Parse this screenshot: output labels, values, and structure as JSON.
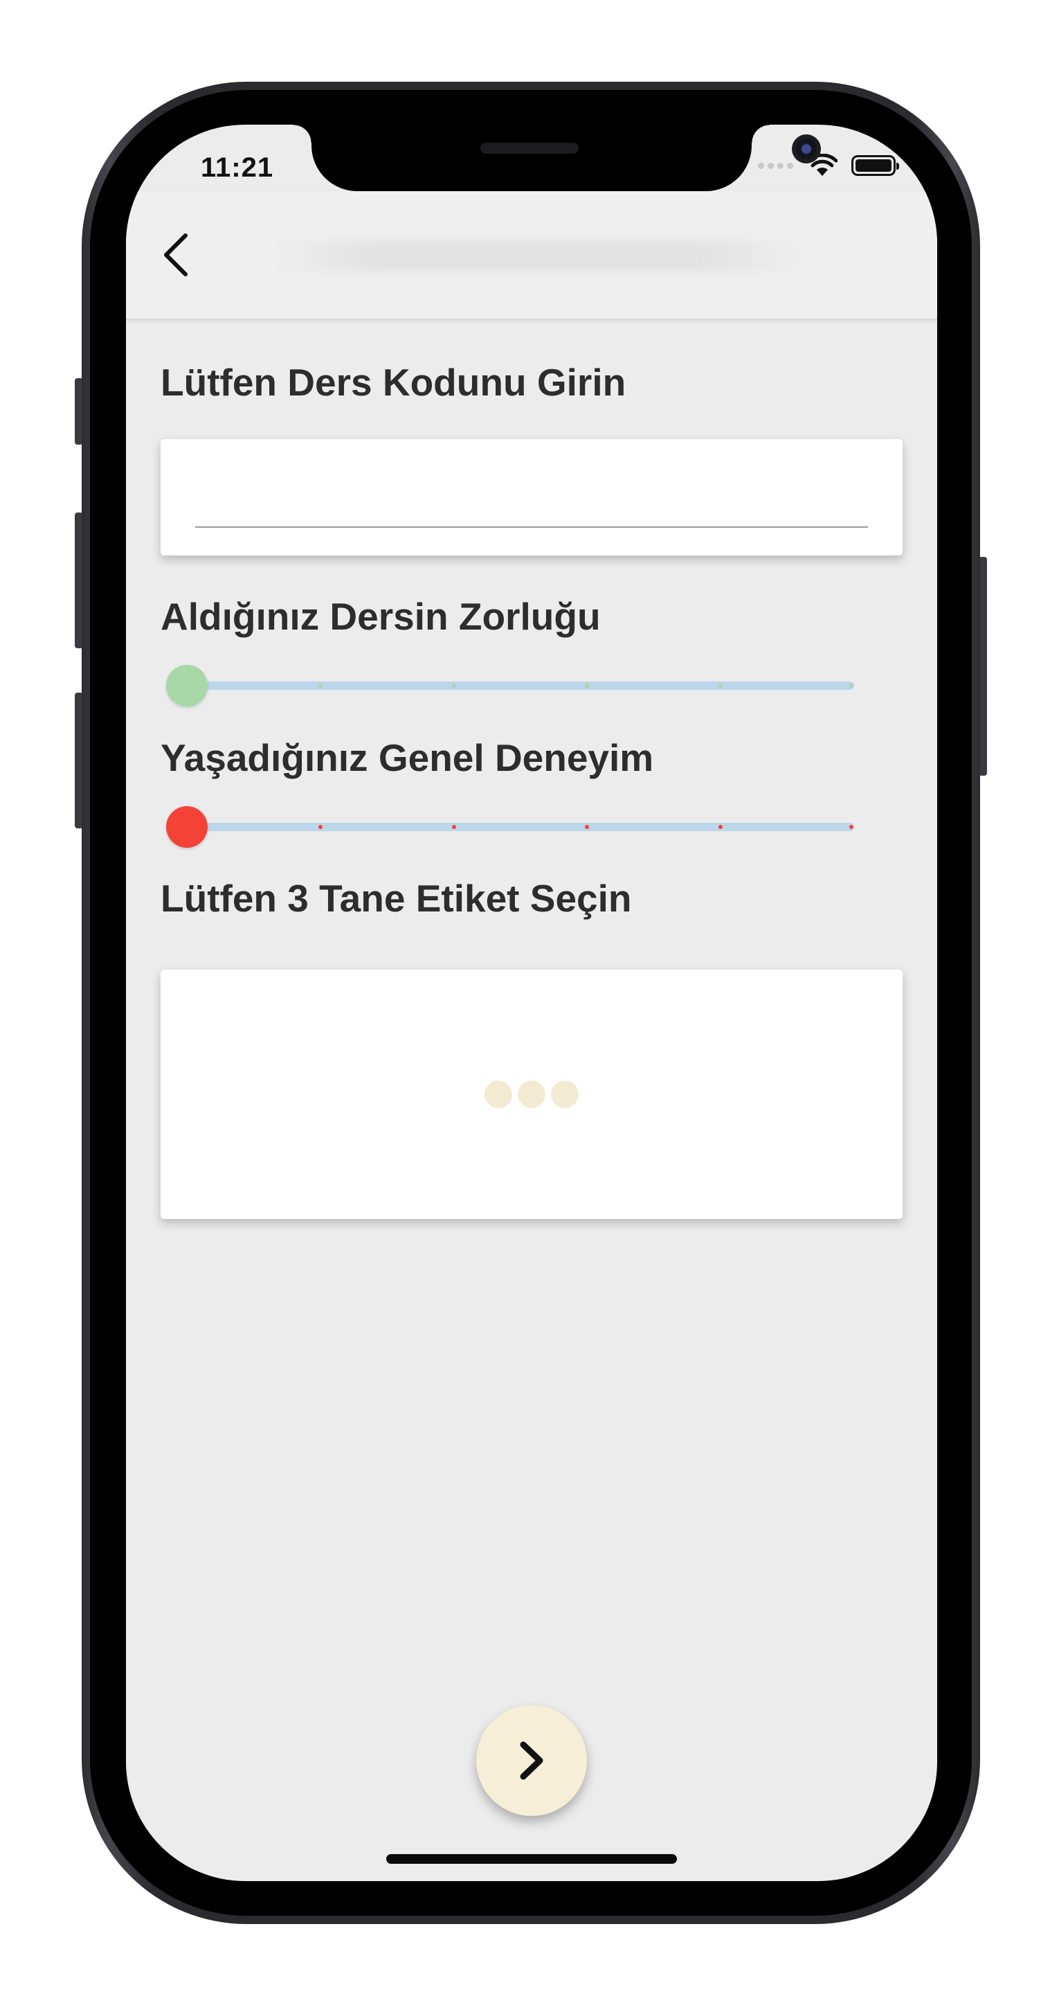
{
  "status_bar": {
    "time": "11:21"
  },
  "nav": {
    "back_icon": "chevron-left-icon",
    "title": ""
  },
  "form": {
    "course_code": {
      "label": "Lütfen Ders Kodunu Girin",
      "value": "",
      "placeholder": ""
    },
    "difficulty": {
      "label": "Aldığınız Dersin Zorluğu",
      "value": 0,
      "min": 0,
      "max": 5,
      "thumb_color": "#a8d8a8",
      "tick_color": "#a8d8a8"
    },
    "experience": {
      "label": "Yaşadığınız Genel Deneyim",
      "value": 0,
      "min": 0,
      "max": 5,
      "thumb_color": "#f44336",
      "tick_color": "#f44336"
    },
    "tags": {
      "label": "Lütfen 3 Tane Etiket Seçin",
      "loading": true,
      "loading_dot_color": "#f3ebd1"
    }
  },
  "fab": {
    "icon": "chevron-right-icon",
    "color": "#f6eed6"
  },
  "colors": {
    "background": "#ececec",
    "track": "#bcd6ea",
    "label": "#2d2d2d"
  }
}
